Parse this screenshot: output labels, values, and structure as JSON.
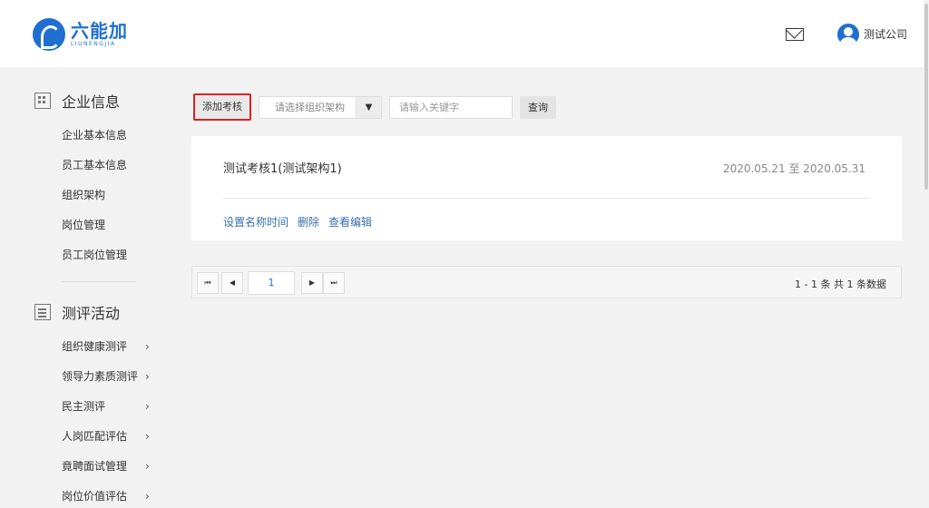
{
  "header": {
    "logo_cn": "六能加",
    "logo_en": "LIUNENGJIA",
    "user_name": "测试公司"
  },
  "sidebar": {
    "section1": {
      "title": "企业信息",
      "items": [
        "企业基本信息",
        "员工基本信息",
        "组织架构",
        "岗位管理",
        "员工岗位管理"
      ]
    },
    "section2": {
      "title": "测评活动",
      "items": [
        "组织健康测评",
        "领导力素质测评",
        "民主测评",
        "人岗匹配评估",
        "竟聘面试管理",
        "岗位价值评估"
      ],
      "chevron": "›"
    }
  },
  "toolbar": {
    "add_label": "添加考核",
    "select_placeholder": "请选择组织架构",
    "select_arrow": "▼",
    "search_placeholder": "请输入关键字",
    "query_label": "查询"
  },
  "card": {
    "title": "测试考核1(测试架构1)",
    "date_range": "2020.05.21 至 2020.05.31",
    "actions": [
      "设置名称时间",
      "删除",
      "查看编辑"
    ]
  },
  "pagination": {
    "first": "⏮",
    "prev": "◀",
    "current_page": "1",
    "next": "▶",
    "last": "⏭",
    "info": "1 - 1 条   共 1 条数据"
  },
  "colors": {
    "brand": "#1f6fd1",
    "highlight_border": "#e02020",
    "link": "#3a6fb0"
  }
}
